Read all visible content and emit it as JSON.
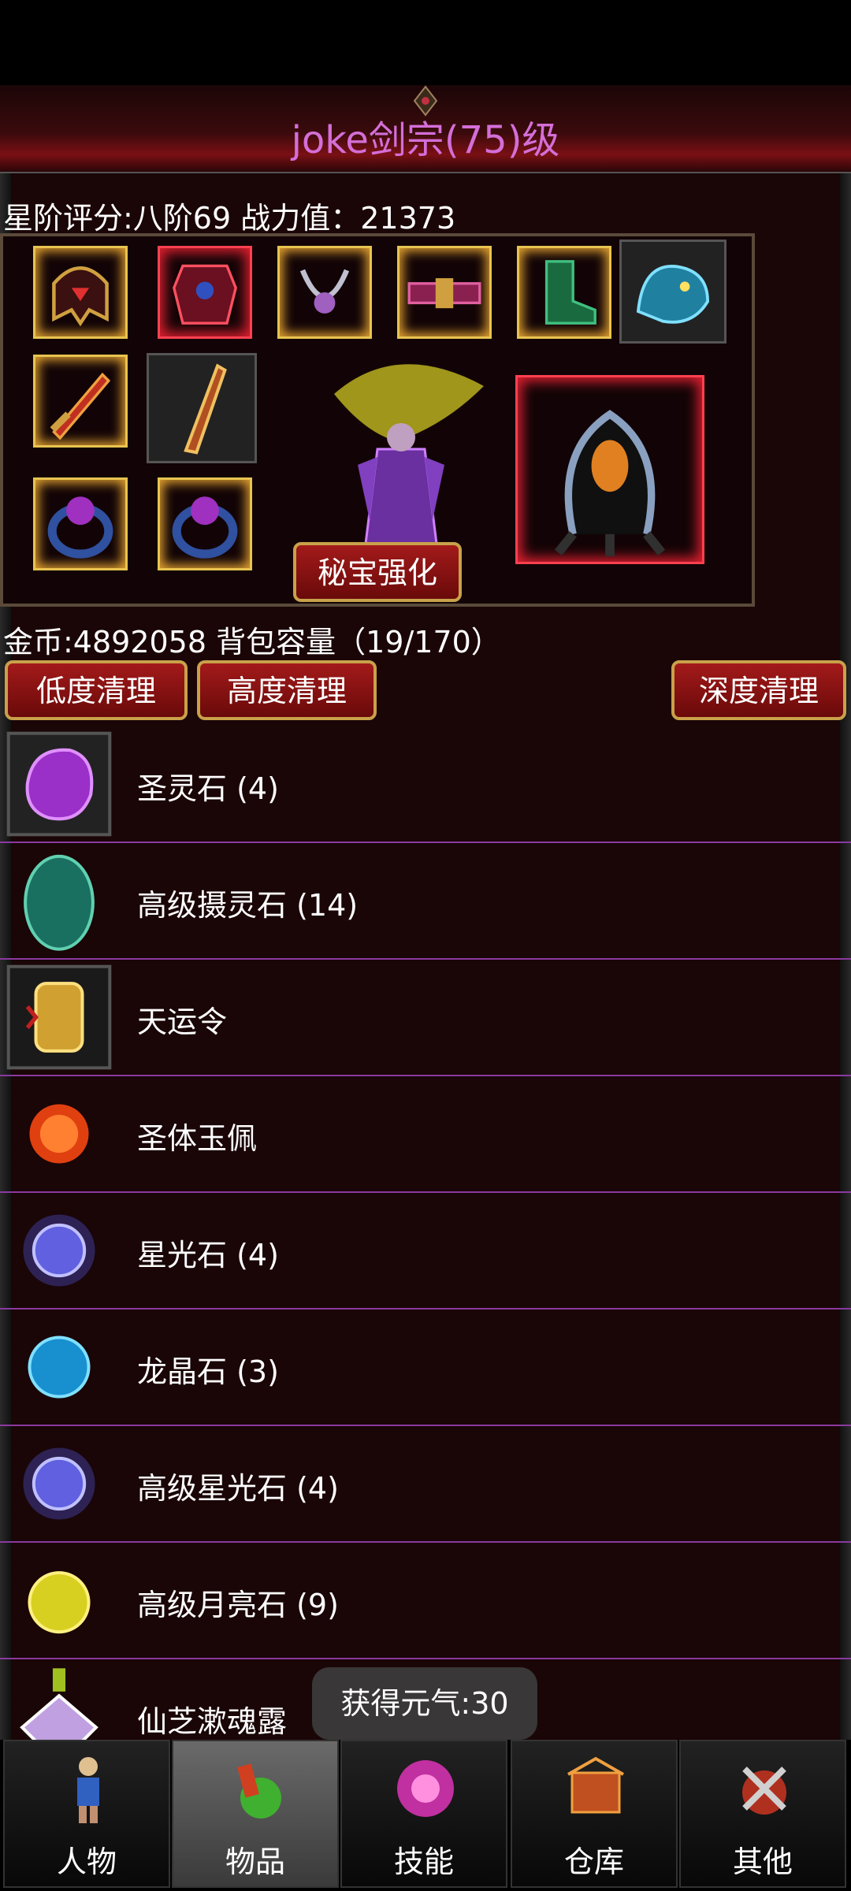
{
  "window": {
    "title": "joke剑宗(75)级"
  },
  "stats": {
    "rating_text": "星阶评分:八阶69 战力值：21373"
  },
  "equip": {
    "secret_button": "秘宝强化"
  },
  "bag": {
    "gold_capacity_text": "金币:4892058 背包容量（19/170）"
  },
  "actions": {
    "low_clean": "低度清理",
    "high_clean": "高度清理",
    "deep_clean": "深度清理"
  },
  "items": [
    {
      "name": "圣灵石 (4)",
      "icon": "purple-gem-icon"
    },
    {
      "name": "高级摄灵石 (14)",
      "icon": "teal-egg-icon"
    },
    {
      "name": "天运令",
      "icon": "gold-token-icon"
    },
    {
      "name": "圣体玉佩",
      "icon": "red-orb-icon"
    },
    {
      "name": "星光石 (4)",
      "icon": "purple-lightning-orb-icon"
    },
    {
      "name": "龙晶石 (3)",
      "icon": "blue-orb-icon"
    },
    {
      "name": "高级星光石 (4)",
      "icon": "purple-lightning-orb-icon"
    },
    {
      "name": "高级月亮石 (9)",
      "icon": "yellow-orb-icon"
    },
    {
      "name": "仙芝漱魂露",
      "icon": "crystal-potion-icon"
    }
  ],
  "toast": {
    "text": "获得元气:30"
  },
  "tabs": [
    {
      "label": "人物",
      "active": false
    },
    {
      "label": "物品",
      "active": true
    },
    {
      "label": "技能",
      "active": false
    },
    {
      "label": "仓库",
      "active": false
    },
    {
      "label": "其他",
      "active": false
    }
  ],
  "colors": {
    "title": "#d46ed8",
    "divider": "#8a3aa0",
    "button_red": "#a31a1a",
    "button_gold": "#c9a14a"
  }
}
